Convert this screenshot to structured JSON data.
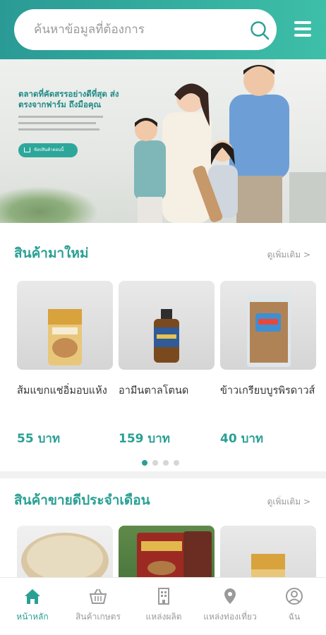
{
  "search": {
    "placeholder": "ค้นหาข้อมูลที่ต้องการ"
  },
  "banner": {
    "title": "ตลาดที่คัดสรรอย่างดีที่สุด ส่งตรงจากฟาร์ม ถึงมือคุณ",
    "button_label": "ช้อปสินค้าตอนนี้"
  },
  "new_products": {
    "title": "สินค้ามาใหม่",
    "more_label": "ดูเพิ่มเติม >",
    "items": [
      {
        "name": "ส้มแขกแช่อิ่มอบแห้ง",
        "price": "55 บาท"
      },
      {
        "name": "อามีนตาลโตนด",
        "price": "159 บาท"
      },
      {
        "name": "ข้าวเกรียบบูรพิรดาวส์",
        "price": "40 บาท"
      }
    ],
    "carousel_pages": 4,
    "carousel_active": 1
  },
  "best_sellers": {
    "title": "สินค้าขายดีประจำเดือน",
    "more_label": "ดูเพิ่มเติม >"
  },
  "bottom_nav": [
    {
      "label": "หน้าหลัก",
      "icon": "home-icon",
      "active": true
    },
    {
      "label": "สินค้าเกษตร",
      "icon": "basket-icon",
      "active": false
    },
    {
      "label": "แหล่งผลิต",
      "icon": "building-icon",
      "active": false
    },
    {
      "label": "แหล่งท่องเที่ยว",
      "icon": "location-pin-icon",
      "active": false
    },
    {
      "label": "ฉัน",
      "icon": "user-icon",
      "active": false
    }
  ],
  "colors": {
    "accent": "#2aa094",
    "header_start": "#2a9a95",
    "header_end": "#3dbfa8"
  }
}
